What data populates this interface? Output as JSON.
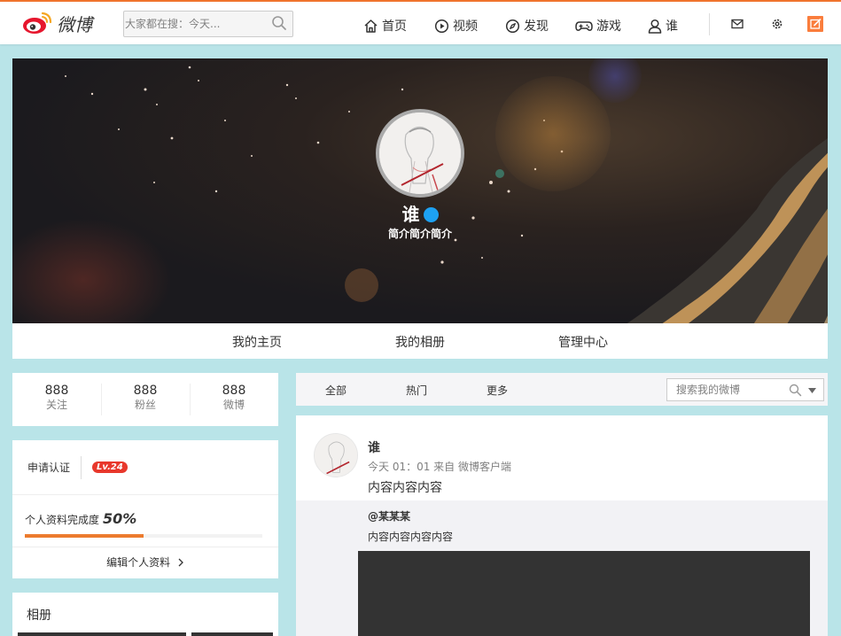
{
  "topbar": {
    "logo_text": "微博",
    "search_placeholder": "大家都在搜：今天...",
    "nav": [
      {
        "label": "首页",
        "icon": "home-icon"
      },
      {
        "label": "视频",
        "icon": "video-icon"
      },
      {
        "label": "发现",
        "icon": "compass-icon"
      },
      {
        "label": "游戏",
        "icon": "gamepad-icon"
      },
      {
        "label": "谁",
        "icon": "user-icon"
      }
    ],
    "tools": [
      "mail-icon",
      "gear-icon",
      "compose-icon"
    ],
    "accent": "#f0742d"
  },
  "cover": {
    "name": "谁",
    "bio": "简介简介简介",
    "verified_color": "#1da1f2"
  },
  "tabs": [
    "我的主页",
    "我的相册",
    "管理中心"
  ],
  "stats": [
    {
      "num": "888",
      "label": "关注"
    },
    {
      "num": "888",
      "label": "粉丝"
    },
    {
      "num": "888",
      "label": "微博"
    }
  ],
  "profile": {
    "apply_label": "申请认证",
    "level": "Lv.24",
    "completion_label": "个人资料完成度",
    "completion_value": "50%",
    "completion_fraction": 0.5,
    "edit_label": "编辑个人资料"
  },
  "album": {
    "title": "相册"
  },
  "feed": {
    "tabs": [
      "全部",
      "热门",
      "更多"
    ],
    "search_placeholder": "搜索我的微博",
    "post": {
      "author": "谁",
      "meta": "今天 01：01 来自 微博客户端",
      "content": "内容内容内容",
      "repost": {
        "user": "@某某某",
        "content": "内容内容内容内容"
      }
    }
  }
}
